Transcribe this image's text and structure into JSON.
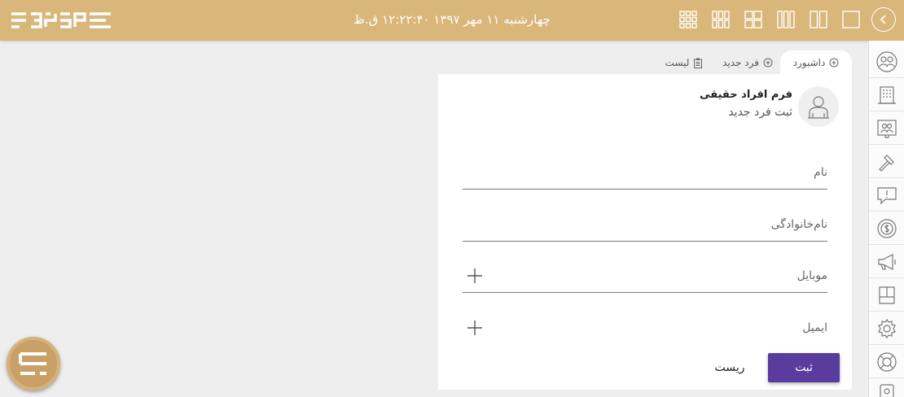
{
  "header": {
    "datetime": "چهارشنبه ۱۱ مهر ۱۳۹۷ ۱۲:۲۲:۴۰ ق.ظ",
    "brand_color": "#d9b679",
    "layouts": [
      "grid-3x3-icon",
      "grid-3x2-icon",
      "grid-2x2-icon",
      "columns-3-icon",
      "columns-2-icon",
      "single-pane-icon"
    ],
    "collapse_icon": "chevron-left-icon"
  },
  "tabs": [
    {
      "label": "داشبورد",
      "icon": "plus-circle-icon",
      "active": true
    },
    {
      "label": "فرد جدید",
      "icon": "plus-circle-icon",
      "active": false
    },
    {
      "label": "لیست",
      "icon": "clipboard-icon",
      "active": false
    }
  ],
  "form": {
    "title": "فرم افراد حقیقی",
    "subtitle": "ثبت فرد جدید",
    "fields": {
      "first_name": {
        "placeholder": "نام",
        "value": ""
      },
      "last_name": {
        "placeholder": "نام‌خانوادگی",
        "value": ""
      },
      "mobile": {
        "placeholder": "موبایل",
        "value": ""
      },
      "email": {
        "placeholder": "ایمیل",
        "value": ""
      }
    },
    "submit_label": "ثبت",
    "reset_label": "ریست",
    "submit_color": "#5a3b9e"
  },
  "sidebar": {
    "items": [
      "users-circle-icon",
      "building-icon",
      "people-board-icon",
      "hammer-icon",
      "alert-message-icon",
      "dollar-coin-icon",
      "megaphone-icon",
      "book-icon",
      "gear-icon",
      "lifebuoy-icon",
      "badge-icon"
    ]
  }
}
